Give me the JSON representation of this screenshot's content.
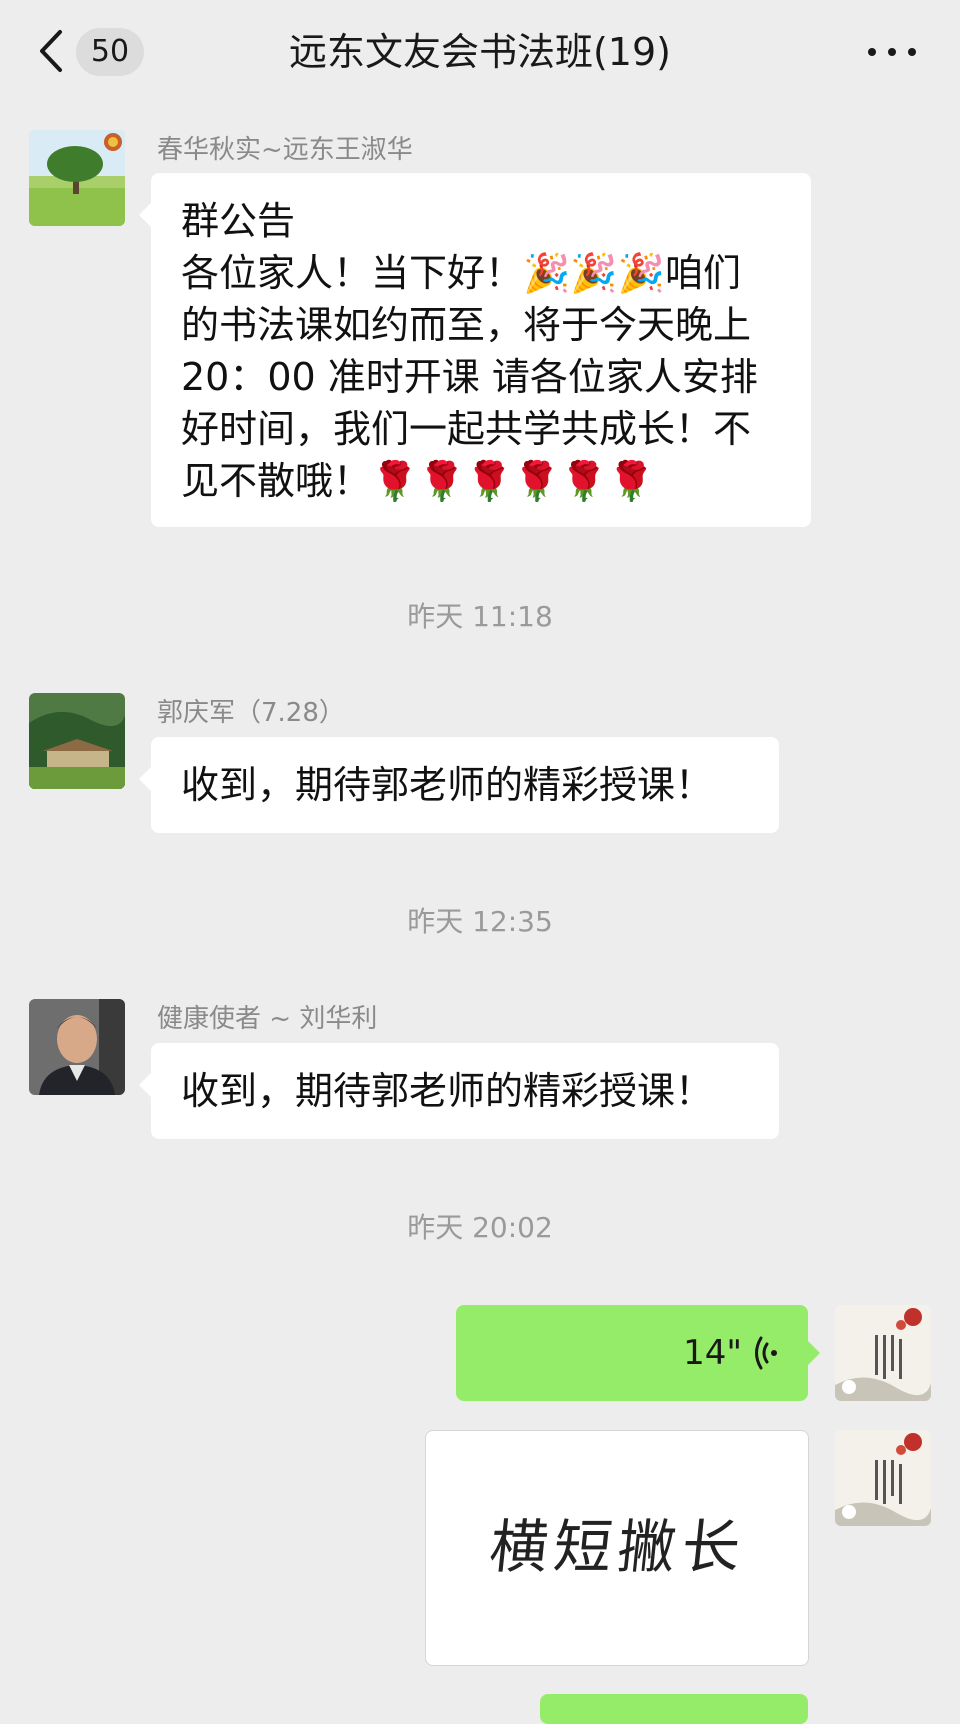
{
  "header": {
    "unread_count": "50",
    "title": "远东文友会书法班(19)"
  },
  "messages": [
    {
      "sender": "春华秋实~远东王淑华",
      "lines": [
        "群公告",
        "各位家人！当下好！🎉🎉🎉咱们",
        "的书法课如约而至，将于今天晚上",
        "20：00 准时开课 请各位家人安排",
        "好时间，我们一起共学共成长！不",
        "见不散哦！🌹🌹🌹🌹🌹🌹"
      ]
    },
    {
      "timestamp": "昨天 11:18"
    },
    {
      "sender": "郭庆军（7.28）",
      "text": "收到，期待郭老师的精彩授课！"
    },
    {
      "timestamp": "昨天 12:35"
    },
    {
      "sender": "健康使者 ~ 刘华利",
      "text": "收到，期待郭老师的精彩授课！"
    },
    {
      "timestamp": "昨天 20:02"
    },
    {
      "self": true,
      "voice_duration": "14\""
    },
    {
      "self": true,
      "image_text": "横短撇长"
    }
  ],
  "colors": {
    "background": "#ededed",
    "incoming_bubble": "#ffffff",
    "outgoing_bubble": "#95ec69",
    "secondary_text": "#8a8a8a"
  },
  "icons": [
    "back-icon",
    "more-icon",
    "voice-wave-icon"
  ]
}
